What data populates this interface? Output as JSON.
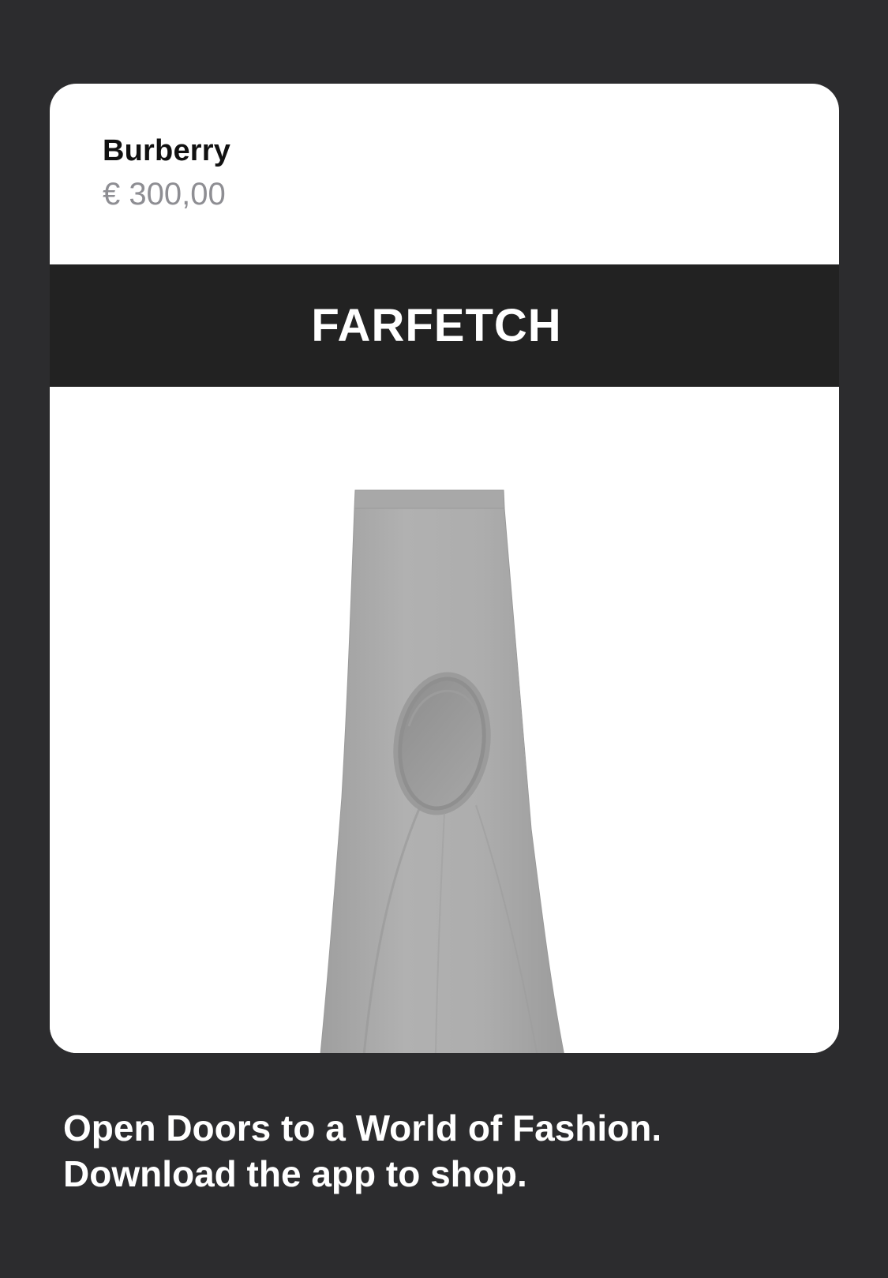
{
  "card": {
    "brand": "Burberry",
    "price": "€ 300,00",
    "store_logo": "FARFETCH",
    "product_image": "grey-cutout-maxi-skirt"
  },
  "promo": {
    "line1": "Open Doors to a World of Fashion.",
    "line2": "Download the app to shop."
  },
  "colors": {
    "background": "#2c2c2e",
    "card": "#ffffff",
    "banner": "#222222",
    "price_gray": "#8e8e93",
    "skirt_gray": "#a9a9a9"
  }
}
